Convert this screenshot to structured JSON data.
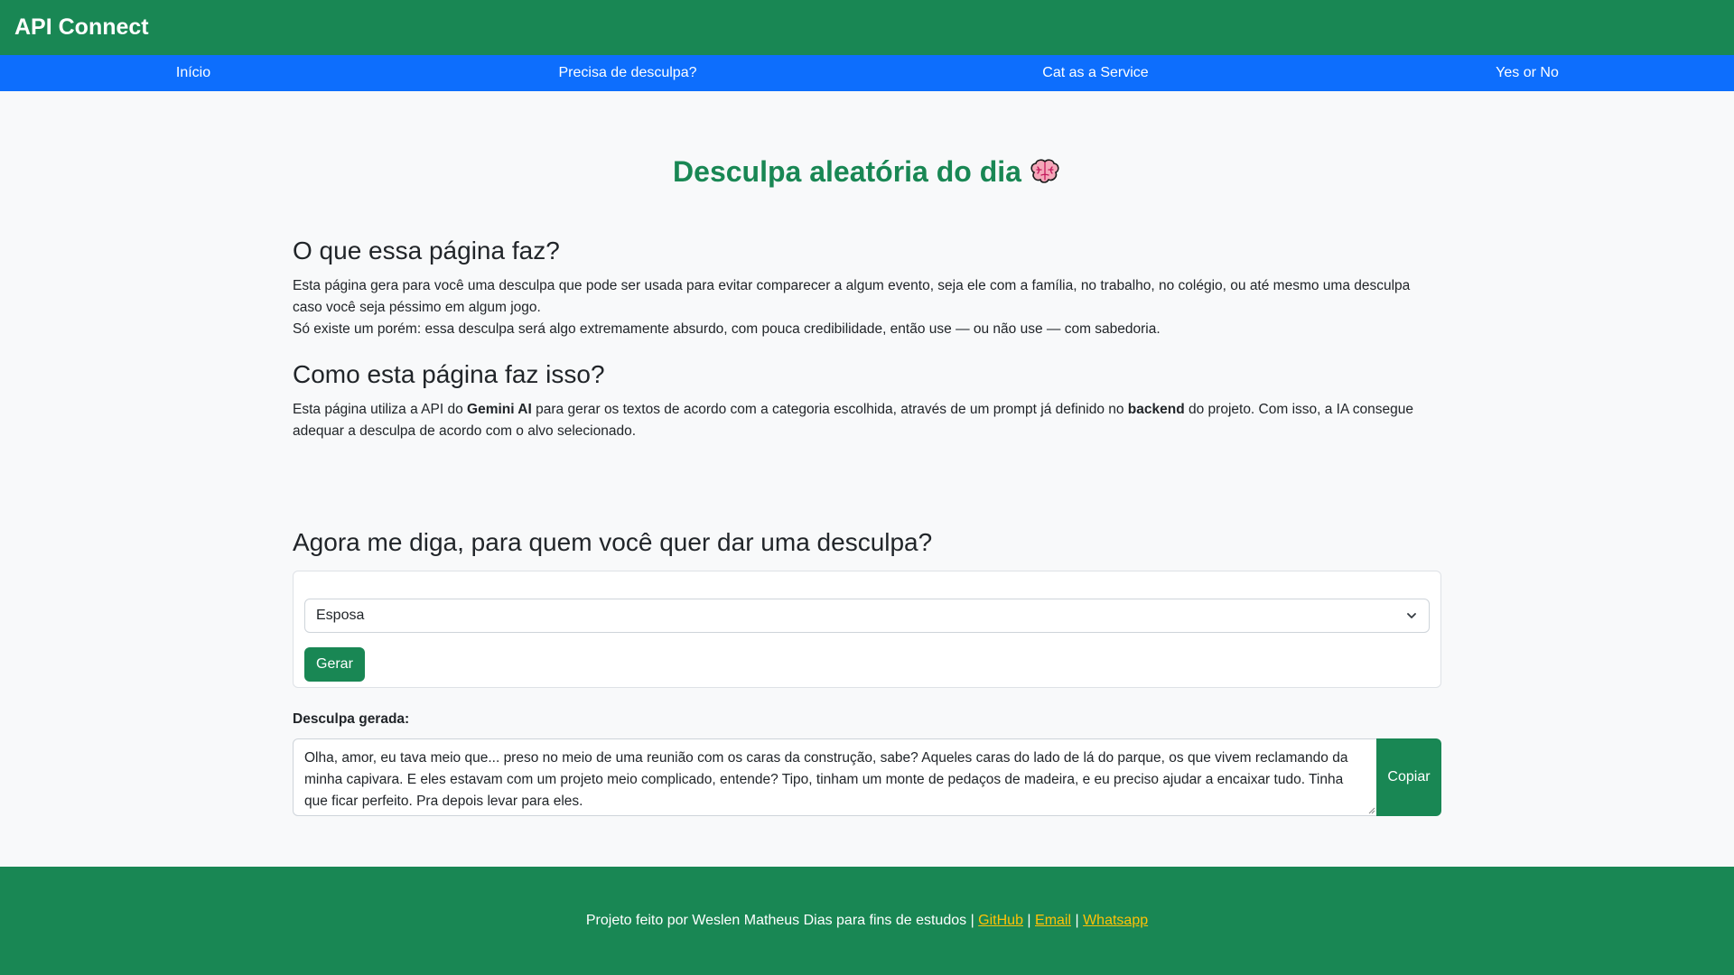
{
  "header": {
    "brand": "API Connect"
  },
  "nav": {
    "items": [
      {
        "label": "Início"
      },
      {
        "label": "Precisa de desculpa?"
      },
      {
        "label": "Cat as a Service"
      },
      {
        "label": "Yes or No"
      }
    ]
  },
  "main": {
    "title": "Desculpa aleatória do dia",
    "title_icon": "brain-icon",
    "section1": {
      "heading": "O que essa página faz?",
      "p1": "Esta página gera para você uma desculpa que pode ser usada para evitar comparecer a algum evento, seja ele com a família, no trabalho, no colégio, ou até mesmo uma desculpa caso você seja péssimo em algum jogo.",
      "p2": "Só existe um porém: essa desculpa será algo extremamente absurdo, com pouca credibilidade, então use — ou não use — com sabedoria."
    },
    "section2": {
      "heading": "Como esta página faz isso?",
      "p_part1": "Esta página utiliza a API do ",
      "p_bold1": "Gemini AI",
      "p_part2": " para gerar os textos de acordo com a categoria escolhida, através de um prompt já definido no ",
      "p_bold2": "backend",
      "p_part3": " do projeto. Com isso, a IA consegue adequar a desculpa de acordo com o alvo selecionado."
    },
    "question_heading": "Agora me diga, para quem você quer dar uma desculpa?",
    "form": {
      "select_value": "Esposa",
      "generate_label": "Gerar"
    },
    "result": {
      "label": "Desculpa gerada:",
      "text": "Olha, amor,  eu tava meio que...  preso no meio de uma reunião com os caras da construção, sabe?  Aqueles caras do lado de lá do parque, os que vivem reclamando da minha capivara.  E eles estavam com um projeto meio complicado, entende?  Tipo,  tinham um monte de pedaços de madeira,  e eu preciso ajudar a encaixar tudo.  Tinha que ficar perfeito. Pra depois levar para eles.",
      "copy_label": "Copiar"
    }
  },
  "footer": {
    "text": "Projeto feito por Weslen Matheus Dias para fins de estudos | ",
    "link_github": "GitHub",
    "sep1": " | ",
    "link_email": "Email",
    "sep2": " | ",
    "link_whatsapp": "Whatsapp"
  },
  "colors": {
    "primary_green": "#198754",
    "nav_blue": "#0d6efd",
    "link_yellow": "#ffc107",
    "page_bg": "#f8f9fa"
  }
}
